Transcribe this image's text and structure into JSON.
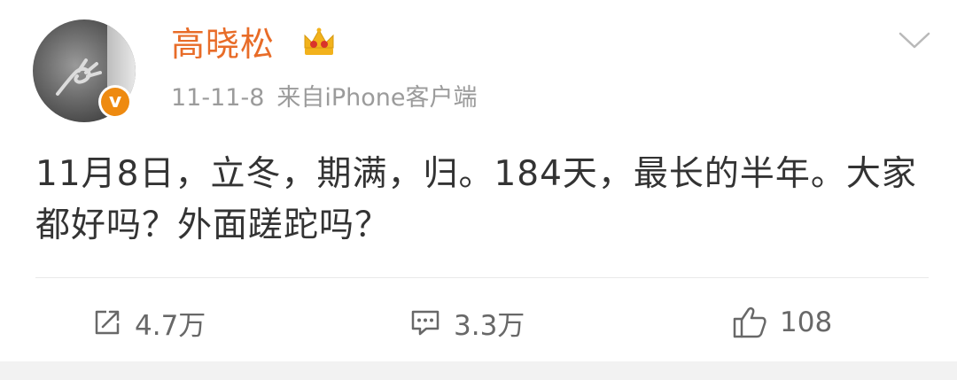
{
  "post": {
    "author": "高晓松",
    "date": "11-11-8",
    "source": "来自iPhone客户端",
    "verified_badge": "v",
    "text": "11月8日，立冬，期满，归。184天，最长的半年。大家都好吗？外面蹉跎吗？",
    "badge_icon": "crown-icon",
    "menu_icon": "chevron-down-icon"
  },
  "actions": {
    "repost": {
      "count": "4.7万",
      "icon": "repost-icon"
    },
    "comment": {
      "count": "3.3万",
      "icon": "comment-icon"
    },
    "like": {
      "count": "108",
      "icon": "thumbs-up-icon"
    }
  },
  "colors": {
    "username": "#e86c28",
    "meta": "#9b9b9b",
    "text": "#333333",
    "action": "#686868",
    "verified": "#ee8a10",
    "crown": "#f2b21c"
  }
}
